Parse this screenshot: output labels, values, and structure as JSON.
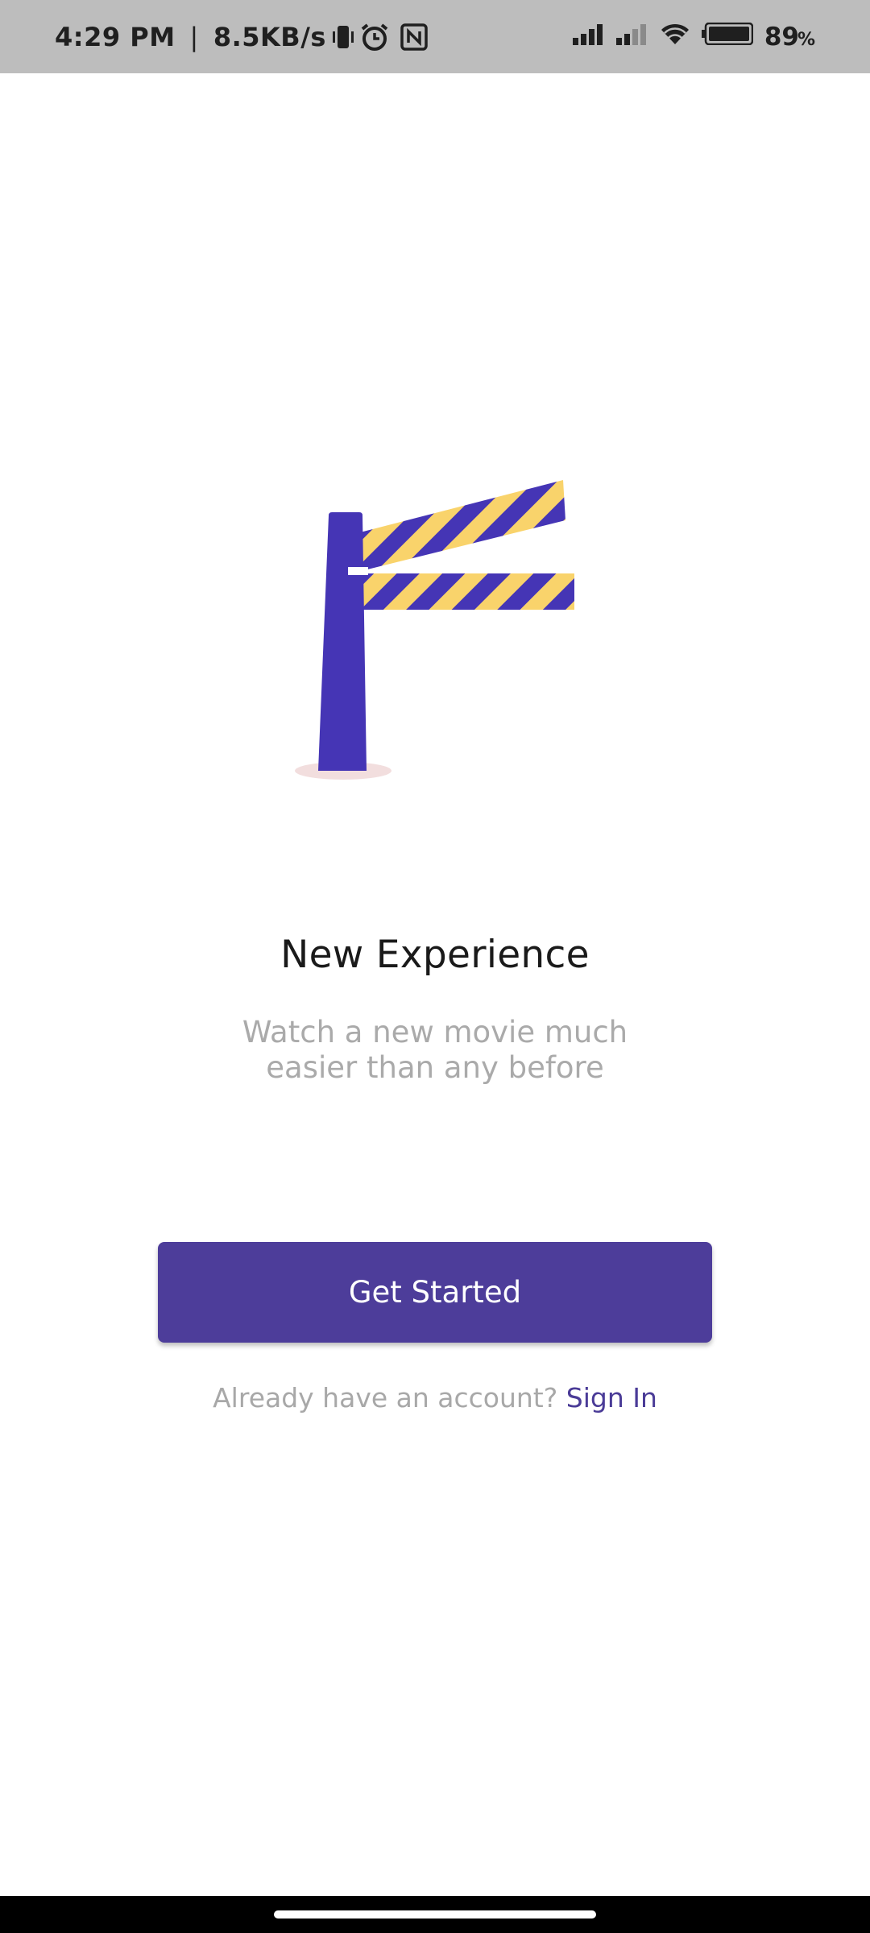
{
  "status_bar": {
    "time": "4:29 PM",
    "separator": "|",
    "speed": "8.5KB/s",
    "battery": "89",
    "battery_unit": "%",
    "icons": [
      "vibrate-icon",
      "alarm-icon",
      "nfc-icon",
      "signal-icon",
      "signal-weak-icon",
      "wifi-icon",
      "battery-icon"
    ]
  },
  "illustration": {
    "name": "barrier-gate-illustration",
    "colors": {
      "pole": "#4535b5",
      "stripe_yellow": "#f9d36b",
      "base_shadow": "#f2dede"
    }
  },
  "onboarding": {
    "title": "New Experience",
    "subtitle": "Watch a new movie much easier than any before"
  },
  "actions": {
    "get_started_label": "Get Started",
    "account_prompt": "Already have an account?",
    "sign_in_label": "Sign In"
  },
  "theme": {
    "primary": "#4d3d9a",
    "link": "#4a3b97",
    "muted_text": "#aaaaaa"
  }
}
